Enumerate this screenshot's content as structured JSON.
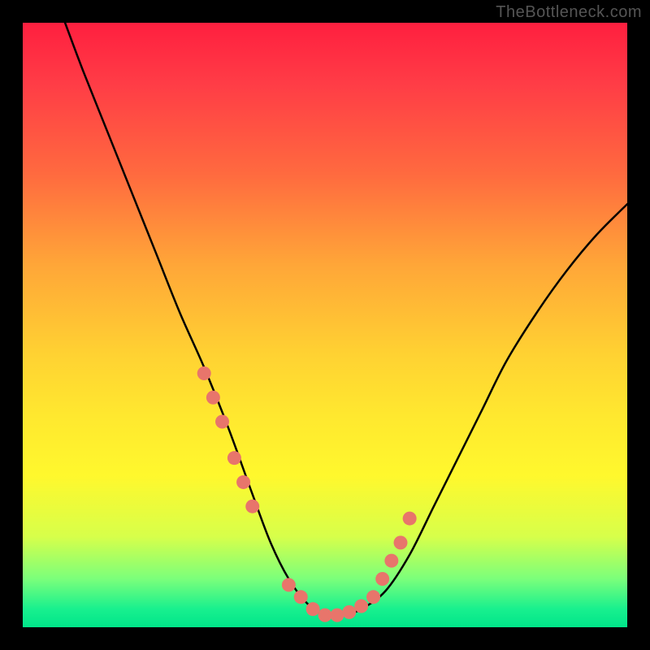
{
  "watermark": "TheBottleneck.com",
  "chart_data": {
    "type": "line",
    "title": "",
    "xlabel": "",
    "ylabel": "",
    "xlim": [
      0,
      100
    ],
    "ylim": [
      0,
      100
    ],
    "series": [
      {
        "name": "bottleneck-curve",
        "x": [
          7,
          10,
          14,
          18,
          22,
          26,
          30,
          34,
          38,
          41,
          44,
          47,
          50,
          53,
          56,
          60,
          64,
          68,
          72,
          76,
          80,
          85,
          90,
          95,
          100
        ],
        "y": [
          100,
          92,
          82,
          72,
          62,
          52,
          43,
          33,
          22,
          14,
          8,
          4,
          2,
          2,
          3,
          6,
          12,
          20,
          28,
          36,
          44,
          52,
          59,
          65,
          70
        ]
      }
    ],
    "markers": {
      "group": "highlight-dots",
      "x": [
        30,
        31.5,
        33,
        35,
        36.5,
        38,
        44,
        46,
        48,
        50,
        52,
        54,
        56,
        58,
        59.5,
        61,
        62.5,
        64
      ],
      "y": [
        42,
        38,
        34,
        28,
        24,
        20,
        7,
        5,
        3,
        2,
        2,
        2.5,
        3.5,
        5,
        8,
        11,
        14,
        18
      ]
    },
    "gradient_stops": [
      {
        "pct": 0,
        "color": "#ff1f3f"
      },
      {
        "pct": 25,
        "color": "#ff6a3f"
      },
      {
        "pct": 55,
        "color": "#ffd232"
      },
      {
        "pct": 75,
        "color": "#fff82d"
      },
      {
        "pct": 92,
        "color": "#7bff7b"
      },
      {
        "pct": 100,
        "color": "#00e58a"
      }
    ]
  }
}
